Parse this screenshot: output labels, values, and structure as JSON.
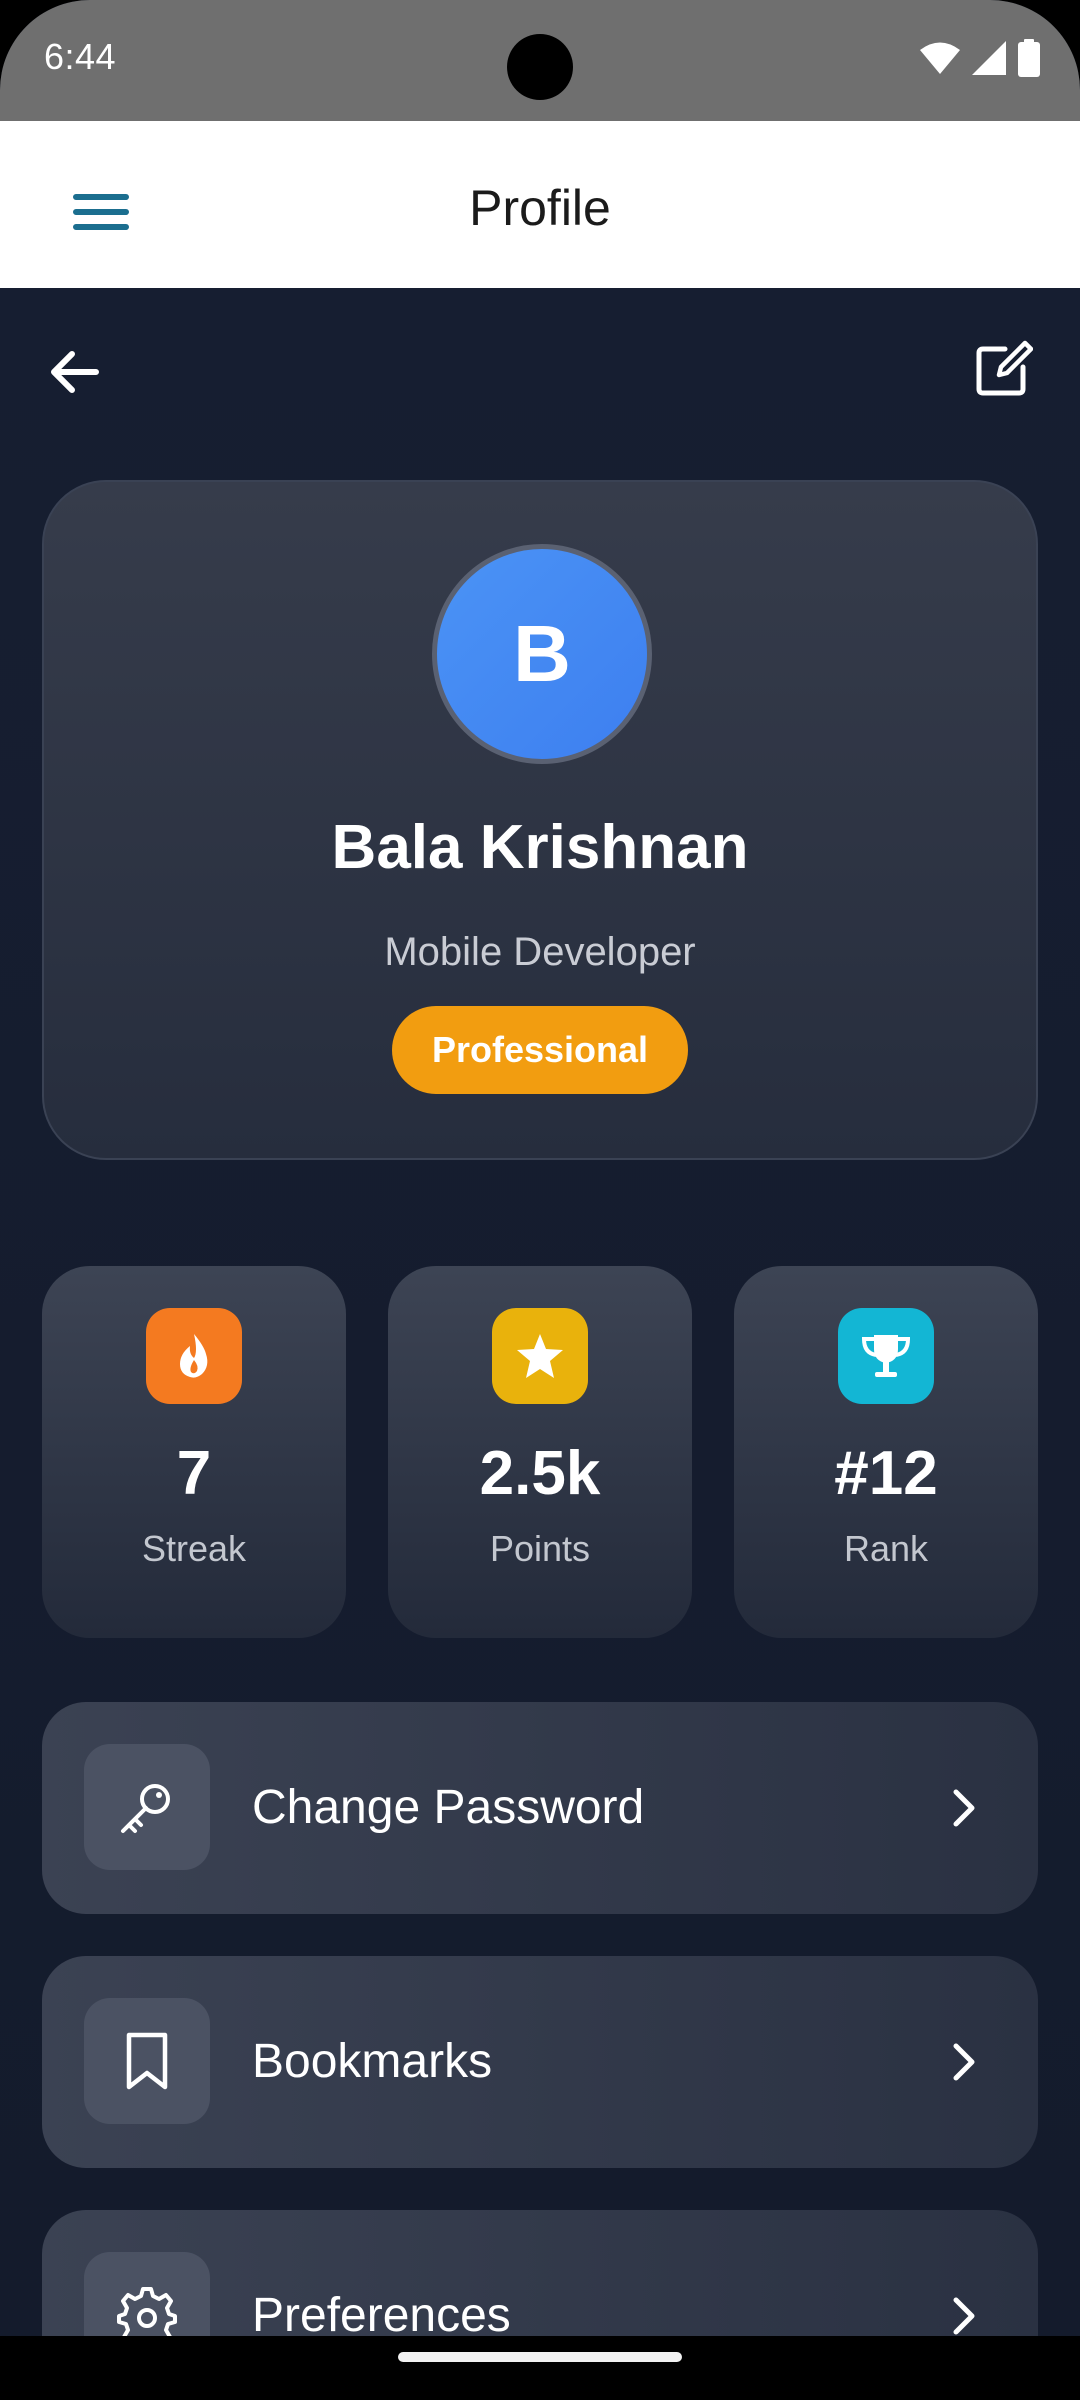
{
  "status_bar": {
    "time": "6:44"
  },
  "app_bar": {
    "title": "Profile"
  },
  "icons": {
    "menu": "hamburger-icon",
    "back": "arrow-left-icon",
    "edit": "edit-icon",
    "streak": "flame-icon",
    "points": "star-icon",
    "rank": "trophy-icon",
    "change_password": "key-icon",
    "bookmarks": "bookmark-icon",
    "preferences": "gear-icon",
    "chevron": "chevron-right-icon"
  },
  "profile": {
    "avatar_initial": "B",
    "name": "Bala Krishnan",
    "role": "Mobile Developer",
    "badge": "Professional"
  },
  "stats": [
    {
      "value": "7",
      "label": "Streak",
      "color": "#f47a20"
    },
    {
      "value": "2.5k",
      "label": "Points",
      "color": "#e9b20c"
    },
    {
      "value": "#12",
      "label": "Rank",
      "color": "#13b6d4"
    }
  ],
  "menu": [
    {
      "label": "Change Password"
    },
    {
      "label": "Bookmarks"
    },
    {
      "label": "Preferences"
    }
  ],
  "colors": {
    "accent": "#1b6e8f",
    "badge": "#f29d10",
    "avatar": "#4a8ff4",
    "background": "#141b2c"
  }
}
